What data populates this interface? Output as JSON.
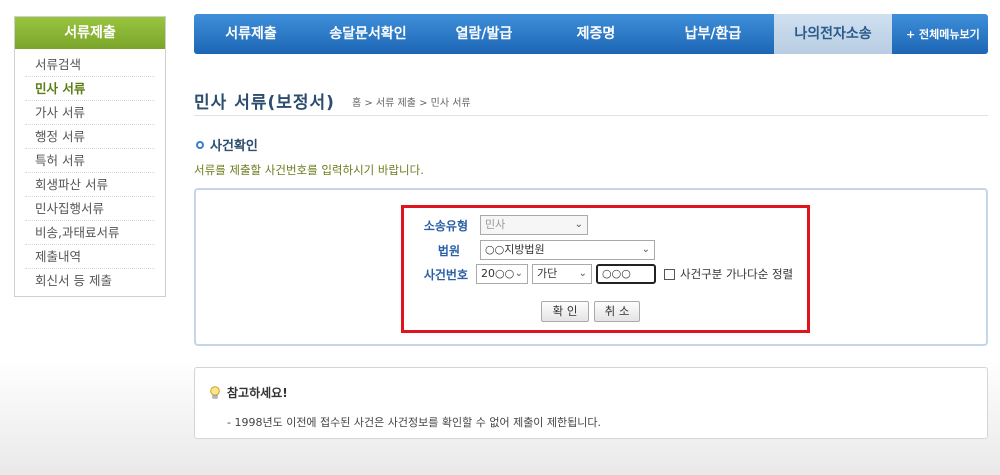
{
  "sidebar": {
    "title": "서류제출",
    "items": [
      {
        "label": "서류검색",
        "active": false
      },
      {
        "label": "민사 서류",
        "active": true
      },
      {
        "label": "가사 서류",
        "active": false
      },
      {
        "label": "행정 서류",
        "active": false
      },
      {
        "label": "특허 서류",
        "active": false
      },
      {
        "label": "회생파산 서류",
        "active": false
      },
      {
        "label": "민사집행서류",
        "active": false
      },
      {
        "label": "비송,과태료서류",
        "active": false
      },
      {
        "label": "제출내역",
        "active": false
      },
      {
        "label": "회신서 등 제출",
        "active": false
      }
    ]
  },
  "nav": {
    "items": [
      "서류제출",
      "송달문서확인",
      "열람/발급",
      "제증명",
      "납부/환급",
      "나의전자소송"
    ],
    "all_menu": "+ 전체메뉴보기"
  },
  "page": {
    "title": "민사 서류(보정서)",
    "breadcrumb": "홈 > 서류 제출 > 민사 서류",
    "section_title": "사건확인",
    "instruction": "서류를 제출할 사건번호를 입력하시기 바랍니다."
  },
  "form": {
    "case_type_label": "소송유형",
    "case_type_value": "민사",
    "court_label": "법원",
    "court_value": "○○지방법원",
    "case_no_label": "사건번호",
    "year_value": "20○○",
    "case_code_value": "가단",
    "case_number_value": "○○○",
    "sort_checkbox_label": "사건구분 가나다순 정렬",
    "confirm_label": "확 인",
    "cancel_label": "취 소"
  },
  "note": {
    "title": "참고하세요!",
    "text": "- 1998년도 이전에 접수된 사건은 사건정보를 확인할 수 없어 제출이 제한됩니다."
  },
  "colors": {
    "sidebar_header": "#8bb83a",
    "nav_bg": "#2a78c8",
    "highlight_border": "#e0141c",
    "label_blue": "#2b5fa6"
  }
}
